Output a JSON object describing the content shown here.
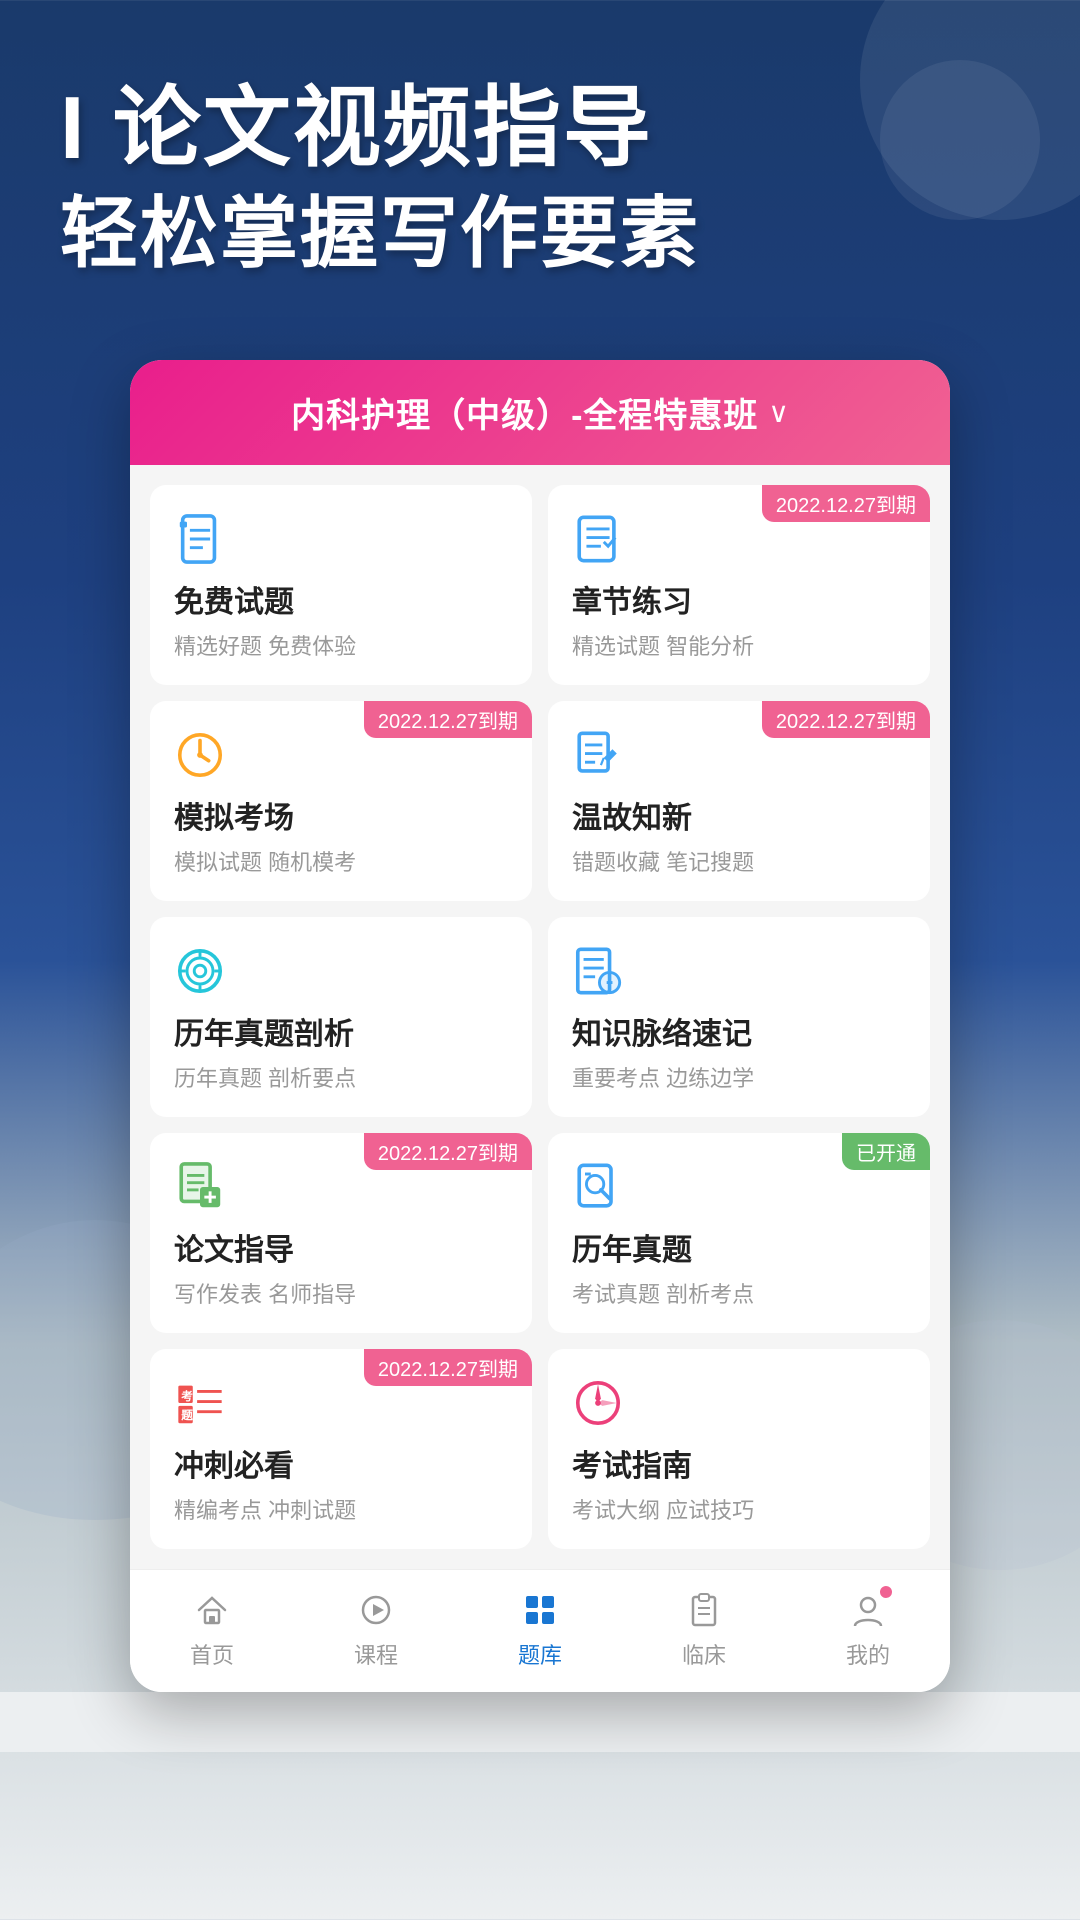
{
  "hero": {
    "line1": "I 论文视频指导",
    "line2": "轻松掌握写作要素"
  },
  "device": {
    "course_selector": {
      "title": "内科护理（中级）-全程特惠班",
      "arrow": "∨"
    },
    "cards": [
      {
        "id": "free-questions",
        "name": "免费试题",
        "desc": "精选好题 免费体验",
        "badge": null,
        "icon": "document-icon",
        "icon_color": "#42a5f5"
      },
      {
        "id": "chapter-practice",
        "name": "章节练习",
        "desc": "精选试题 智能分析",
        "badge": "2022.12.27到期",
        "badge_type": "pink",
        "icon": "list-icon",
        "icon_color": "#42a5f5"
      },
      {
        "id": "mock-exam",
        "name": "模拟考场",
        "desc": "模拟试题 随机模考",
        "badge": "2022.12.27到期",
        "badge_type": "pink",
        "icon": "clock-icon",
        "icon_color": "#ffa726"
      },
      {
        "id": "review",
        "name": "温故知新",
        "desc": "错题收藏 笔记搜题",
        "badge": "2022.12.27到期",
        "badge_type": "pink",
        "icon": "edit-icon",
        "icon_color": "#42a5f5"
      },
      {
        "id": "past-analysis",
        "name": "历年真题剖析",
        "desc": "历年真题 剖析要点",
        "badge": null,
        "icon": "target-icon",
        "icon_color": "#26c6da"
      },
      {
        "id": "knowledge-map",
        "name": "知识脉络速记",
        "desc": "重要考点 边练边学",
        "badge": null,
        "icon": "notes-icon",
        "icon_color": "#42a5f5"
      },
      {
        "id": "thesis-guide",
        "name": "论文指导",
        "desc": "写作发表 名师指导",
        "badge": "2022.12.27到期",
        "badge_type": "pink",
        "icon": "paper-icon",
        "icon_color": "#66bb6a"
      },
      {
        "id": "past-exams",
        "name": "历年真题",
        "desc": "考试真题 剖析考点",
        "badge": "已开通",
        "badge_type": "green",
        "icon": "exam-icon",
        "icon_color": "#42a5f5"
      },
      {
        "id": "sprint",
        "name": "冲刺必看",
        "desc": "精编考点 冲刺试题",
        "badge": "2022.12.27到期",
        "badge_type": "pink",
        "icon": "keypoint-icon",
        "icon_color": "#ef5350"
      },
      {
        "id": "exam-guide",
        "name": "考试指南",
        "desc": "考试大纲 应试技巧",
        "badge": null,
        "icon": "compass-icon",
        "icon_color": "#ec407a"
      }
    ],
    "nav": [
      {
        "id": "home",
        "label": "首页",
        "icon": "home-icon",
        "active": false
      },
      {
        "id": "course",
        "label": "课程",
        "icon": "play-icon",
        "active": false
      },
      {
        "id": "questions",
        "label": "题库",
        "icon": "grid-icon",
        "active": true
      },
      {
        "id": "clinical",
        "label": "临床",
        "icon": "clipboard-icon",
        "active": false
      },
      {
        "id": "mine",
        "label": "我的",
        "icon": "user-icon",
        "active": false
      }
    ]
  }
}
